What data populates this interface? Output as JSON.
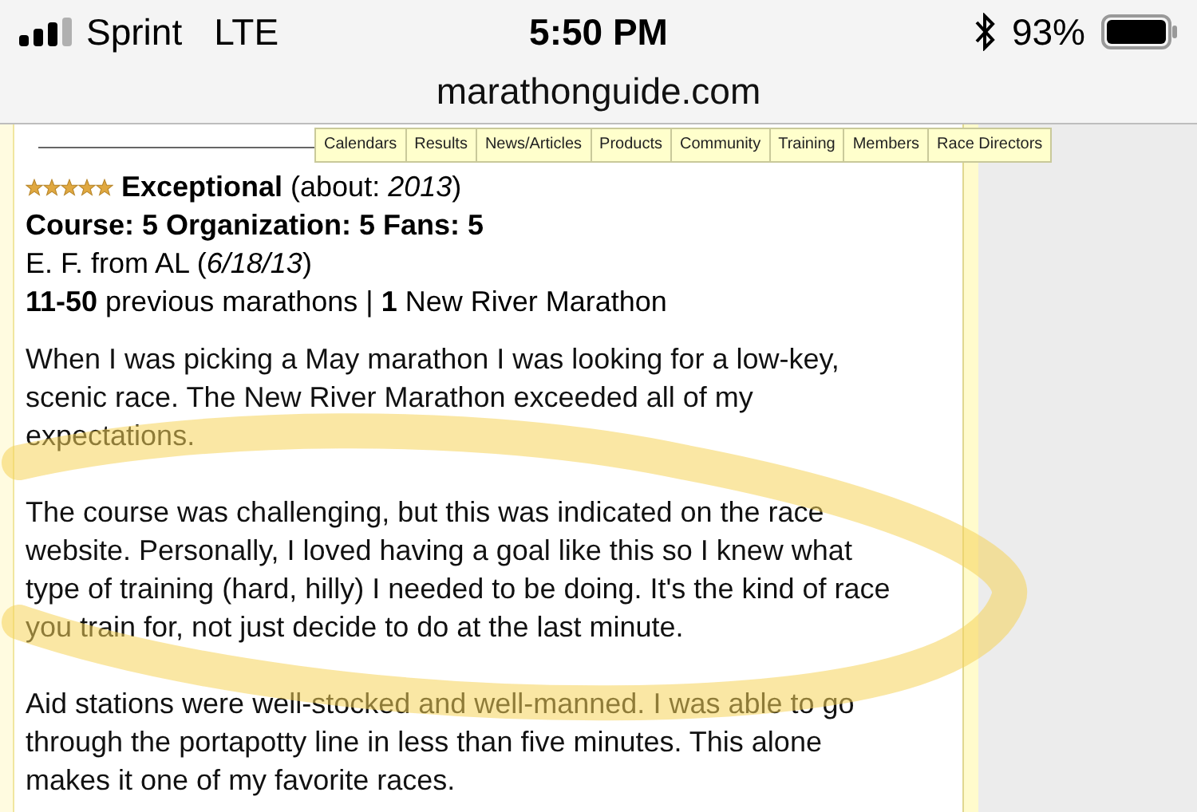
{
  "status_bar": {
    "carrier": "Sprint",
    "network": "LTE",
    "time": "5:50 PM",
    "battery": "93%"
  },
  "address_bar": {
    "url": "marathonguide.com"
  },
  "nav_menu": [
    {
      "label": "Calendars"
    },
    {
      "label": "Results"
    },
    {
      "label": "News/Articles"
    },
    {
      "label": "Products"
    },
    {
      "label": "Community"
    },
    {
      "label": "Training"
    },
    {
      "label": "Members"
    },
    {
      "label": "Race Directors"
    }
  ],
  "review": {
    "stars": 5,
    "rating": "Exceptional",
    "about": "(about: *2013*)",
    "scores": "Course: 5 Organization: 5 Fans: 5",
    "reviewer": "E. F. from AL (*6/18/13*)",
    "experience": "**11-50** previous marathons | **1** New River Marathon",
    "paragraphs": [
      "When I was picking a May marathon I was looking for a low-key, scenic race. The New River Marathon exceeded all of my expectations.",
      "The course was challenging, but this was indicated on the race website. Personally, I loved having a goal like this so I knew what type of training (hard, hilly) I needed to be doing. It's the kind of race you train for, not just decide to do at the last minute.",
      "Aid stations were well-stocked and well-manned. I was able to go through the portapotty line in less than five minutes. This alone makes it one of my favorite races."
    ]
  }
}
